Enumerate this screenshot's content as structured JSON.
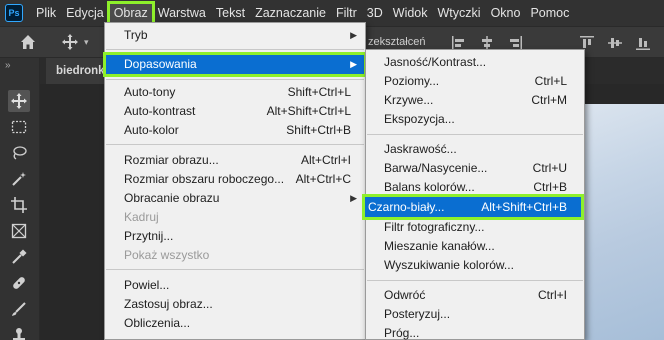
{
  "app": {
    "logo": "Ps"
  },
  "menubar": {
    "items": [
      {
        "label": "Plik"
      },
      {
        "label": "Edycja"
      },
      {
        "label": "Obraz"
      },
      {
        "label": "Warstwa"
      },
      {
        "label": "Tekst"
      },
      {
        "label": "Zaznaczanie"
      },
      {
        "label": "Filtr"
      },
      {
        "label": "3D"
      },
      {
        "label": "Widok"
      },
      {
        "label": "Wtyczki"
      },
      {
        "label": "Okno"
      },
      {
        "label": "Pomoc"
      }
    ],
    "active": "Obraz"
  },
  "options_bar": {
    "transform_label_partial": "zekształceń",
    "icons": [
      "home-icon",
      "move-icon",
      "align-icons"
    ]
  },
  "document": {
    "tab_label": "biedronka"
  },
  "menu_obraz": {
    "items": [
      {
        "label": "Tryb",
        "shortcut": "",
        "submenu": true
      },
      {
        "label": "Dopasowania",
        "shortcut": "",
        "submenu": true,
        "highlighted": true
      },
      {
        "label": "Auto-tony",
        "shortcut": "Shift+Ctrl+L"
      },
      {
        "label": "Auto-kontrast",
        "shortcut": "Alt+Shift+Ctrl+L"
      },
      {
        "label": "Auto-kolor",
        "shortcut": "Shift+Ctrl+B"
      },
      {
        "label": "Rozmiar obrazu...",
        "shortcut": "Alt+Ctrl+I"
      },
      {
        "label": "Rozmiar obszaru roboczego...",
        "shortcut": "Alt+Ctrl+C"
      },
      {
        "label": "Obracanie obrazu",
        "shortcut": "",
        "submenu": true
      },
      {
        "label": "Kadruj",
        "shortcut": "",
        "disabled": true
      },
      {
        "label": "Przytnij...",
        "shortcut": ""
      },
      {
        "label": "Pokaż wszystko",
        "shortcut": "",
        "disabled": true
      },
      {
        "label": "Powiel...",
        "shortcut": ""
      },
      {
        "label": "Zastosuj obraz...",
        "shortcut": ""
      },
      {
        "label": "Obliczenia...",
        "shortcut": ""
      }
    ]
  },
  "menu_dopasowania": {
    "items": [
      {
        "label": "Jasność/Kontrast...",
        "shortcut": ""
      },
      {
        "label": "Poziomy...",
        "shortcut": "Ctrl+L"
      },
      {
        "label": "Krzywe...",
        "shortcut": "Ctrl+M"
      },
      {
        "label": "Ekspozycja...",
        "shortcut": ""
      },
      {
        "label": "Jaskrawość...",
        "shortcut": ""
      },
      {
        "label": "Barwa/Nasycenie...",
        "shortcut": "Ctrl+U"
      },
      {
        "label": "Balans kolorów...",
        "shortcut": "Ctrl+B"
      },
      {
        "label": "Czarno-biały...",
        "shortcut": "Alt+Shift+Ctrl+B",
        "highlighted": true
      },
      {
        "label": "Filtr fotograficzny...",
        "shortcut": ""
      },
      {
        "label": "Mieszanie kanałów...",
        "shortcut": ""
      },
      {
        "label": "Wyszukiwanie kolorów...",
        "shortcut": ""
      },
      {
        "label": "Odwróć",
        "shortcut": "Ctrl+I"
      },
      {
        "label": "Posteryzuj...",
        "shortcut": ""
      },
      {
        "label": "Próg...",
        "shortcut": ""
      }
    ]
  },
  "colors": {
    "highlight": "#0a6ed1",
    "callout_outline": "#8ef02b",
    "menu_bg": "#f0f0f0",
    "app_bg": "#323232"
  }
}
